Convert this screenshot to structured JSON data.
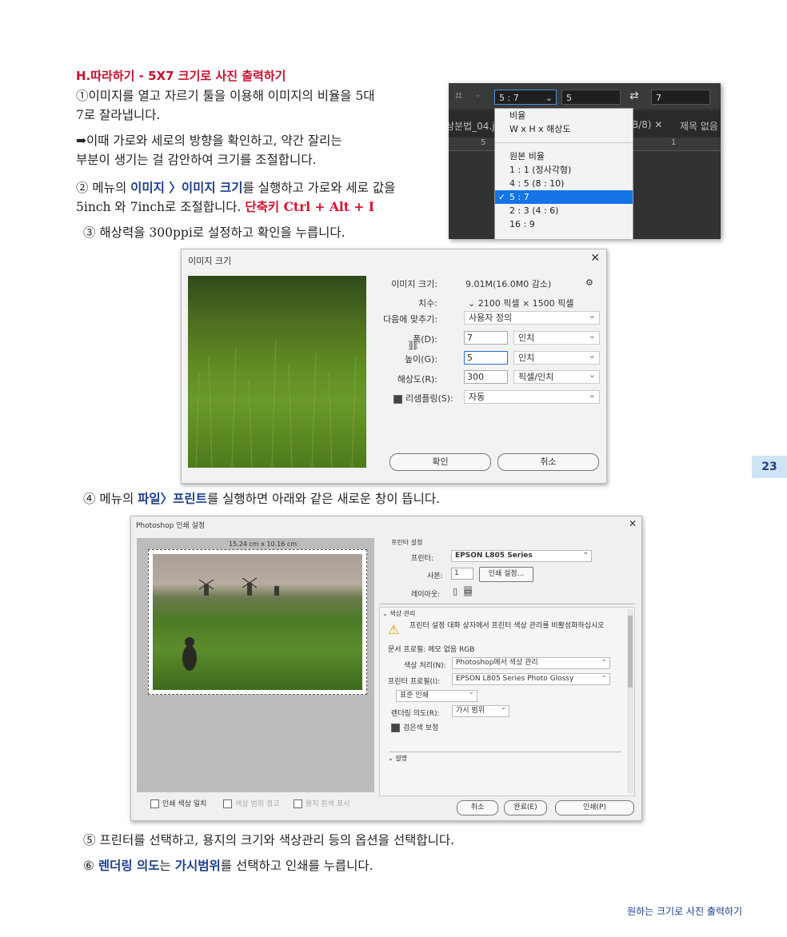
{
  "heading": "H.따라하기 - 5X7 크기로 사진 출력하기",
  "steps": {
    "s1_a": "①이미지를 열고 자르기 툴을 이용해 이미지의 비율을 5대",
    "s1_b": "7로 잘라냅니다.",
    "note_a": "➡이때 가로와 세로의 방향을 확인하고, 약간 잘리는",
    "note_b": "부분이 생기는 걸 감안하여 크기를 조절합니다.",
    "s2_pre": "② 메뉴의 ",
    "s2_menu": "이미지 〉이미지 크기",
    "s2_mid": "를 실행하고 가로와 세로 값을",
    "s2_b": "5inch 와 7inch로 조절합니다. ",
    "s2_shortcut": "단축키 Ctrl + Alt + I",
    "s3": "③ 해상력을 300ppi로 설정하고 확인을 누릅니다.",
    "s4_pre": "④ 메뉴의 ",
    "s4_menu": "파일〉프린트",
    "s4_post": "를 실행하면 아래와 같은 새로운 창이 뜹니다.",
    "s5": "⑤ 프린터를 선택하고, 용지의 크기와 색상관리 등의 옵션을 선택합니다.",
    "s6_pre": "⑥ ",
    "s6_a": "렌더링 의도",
    "s6_mid": "는 ",
    "s6_b": "가시범위",
    "s6_post": "를 선택하고 인쇄를 누릅니다."
  },
  "ps_toolbar": {
    "ratio_value": "5 : 7",
    "width_value": "5",
    "height_value": "7",
    "tab_left": "삼분법_04.j",
    "tab_mid": "B/8)",
    "tab_right": "제목 없음",
    "ruler_left": "5",
    "ruler_right": "1",
    "dropdown": [
      "비율",
      "W x H x 해상도",
      "원본 비율",
      "1 : 1 (정사각형)",
      "4 : 5 (8 : 10)",
      "5 : 7",
      "2 : 3 (4 : 6)",
      "16 : 9"
    ],
    "selected_index": 5
  },
  "image_size_dialog": {
    "title": "이미지 크기",
    "close": "✕",
    "size_label": "이미지 크기:",
    "size_value": "9.01M(16.0M0 감소)",
    "dims_label": "치수:",
    "dims_value": "2100 픽셀 × 1500 픽셀",
    "fit_label": "다음에 맞추기:",
    "fit_value": "사용자 정의",
    "width_label": "폭(D):",
    "width_value": "7",
    "width_unit": "인치",
    "height_label": "높이(G):",
    "height_value": "5",
    "height_unit": "인치",
    "res_label": "해상도(R):",
    "res_value": "300",
    "res_unit": "픽셀/인치",
    "resample_label": "리샘플링(S):",
    "resample_value": "자동",
    "ok": "확인",
    "cancel": "취소"
  },
  "print_dialog": {
    "title": "Photoshop 인쇄 설정",
    "close": "✕",
    "paper_size": "15.24 cm x 10.16 cm",
    "printer_section": "프린터 설정",
    "printer_label": "프린터:",
    "printer_value": "EPSON L805 Series",
    "copies_label": "사본:",
    "copies_value": "1",
    "print_settings_btn": "인쇄 설정...",
    "layout_label": "레이아웃:",
    "color_section": "색상 관리",
    "warning": "프린터 설정 대화 상자에서 프린터 색상 관리를 비활성화하십시오",
    "doc_profile": "문서 프로필: 메모 없음 RGB",
    "color_handling_label": "색상 처리(N):",
    "color_handling_value": "Photoshop에서 색상 관리",
    "printer_profile_label": "프린터 프로필(I):",
    "printer_profile_value": "EPSON L805 Series Photo Glossy",
    "normal_print": "표준 인쇄",
    "intent_label": "렌더링 의도(R):",
    "intent_value": "가시 범위",
    "bpc_label": "검은색 보정",
    "desc_section": "설명",
    "match_colors": "인쇄 색상 일치",
    "gamut_warning": "색상 범위 경고",
    "paper_white": "용지 흰색 표시",
    "cancel": "취소",
    "done": "완료(E)",
    "print": "인쇄(P)"
  },
  "page_number": "23",
  "footer": "원하는 크기로 사진 출력하기",
  "colors": {
    "heading": "#c8102e",
    "highlight": "#1d3f8f",
    "shortcut": "#d8102e"
  }
}
